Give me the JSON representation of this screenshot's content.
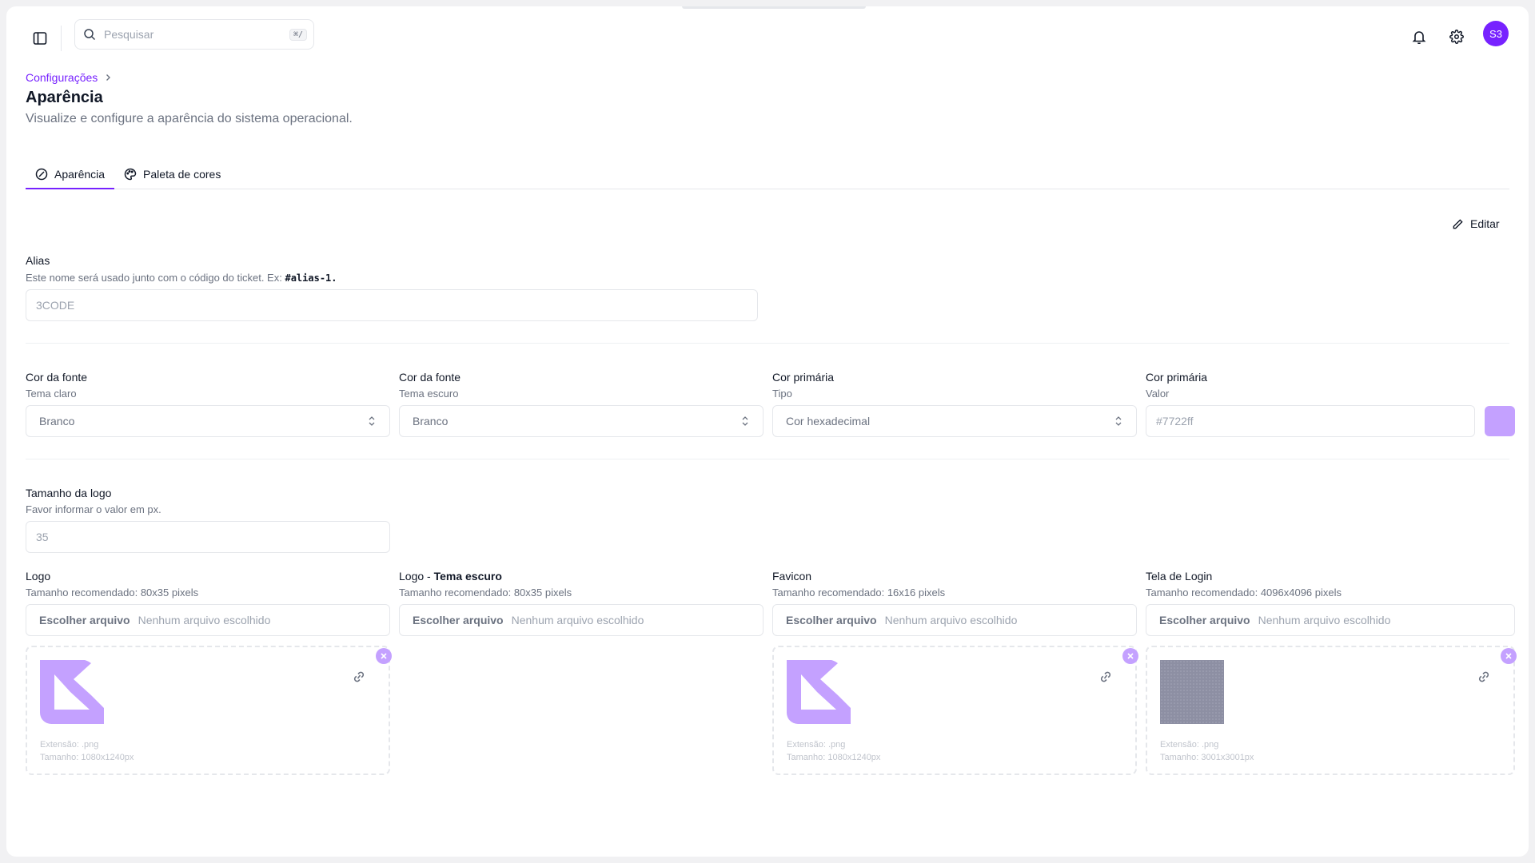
{
  "header": {
    "search_placeholder": "Pesquisar",
    "search_shortcut": "⌘/",
    "avatar_initials": "S3"
  },
  "breadcrumb": {
    "parent": "Configurações"
  },
  "page": {
    "title": "Aparência",
    "subtitle": "Visualize e configure a aparência do sistema operacional."
  },
  "tabs": [
    {
      "label": "Aparência",
      "active": true
    },
    {
      "label": "Paleta de cores",
      "active": false
    }
  ],
  "edit_label": "Editar",
  "alias": {
    "label": "Alias",
    "help": "Este nome será usado junto com o código do ticket. Ex:",
    "example": "#alias-1.",
    "value": "3CODE"
  },
  "colors": [
    {
      "label": "Cor da fonte",
      "sub": "Tema claro",
      "value": "Branco"
    },
    {
      "label": "Cor da fonte",
      "sub": "Tema escuro",
      "value": "Branco"
    },
    {
      "label": "Cor primária",
      "sub": "Tipo",
      "value": "Cor hexadecimal"
    },
    {
      "label": "Cor primária",
      "sub": "Valor",
      "value": "#7722ff"
    }
  ],
  "logo_size": {
    "label": "Tamanho da logo",
    "help": "Favor informar o valor em px.",
    "value": "35"
  },
  "uploads": [
    {
      "label": "Logo",
      "label_bold": "",
      "help": "Tamanho recomendado: 80x35 pixels",
      "button": "Escolher arquivo",
      "none": "Nenhum arquivo escolhido",
      "preview": {
        "ext": "Extensão: .png",
        "size": "Tamanho: 1080x1240px"
      }
    },
    {
      "label": "Logo - ",
      "label_bold": "Tema escuro",
      "help": "Tamanho recomendado: 80x35 pixels",
      "button": "Escolher arquivo",
      "none": "Nenhum arquivo escolhido",
      "preview": null
    },
    {
      "label": "Favicon",
      "label_bold": "",
      "help": "Tamanho recomendado: 16x16 pixels",
      "button": "Escolher arquivo",
      "none": "Nenhum arquivo escolhido",
      "preview": {
        "ext": "Extensão: .png",
        "size": "Tamanho: 1080x1240px"
      }
    },
    {
      "label": "Tela de Login",
      "label_bold": "",
      "help": "Tamanho recomendado: 4096x4096 pixels",
      "button": "Escolher arquivo",
      "none": "Nenhum arquivo escolhido",
      "preview": {
        "ext": "Extensão: .png",
        "size": "Tamanho: 3001x3001px"
      }
    }
  ],
  "theme": {
    "accent": "#7722ff",
    "accent_light": "#c4a1ff"
  }
}
